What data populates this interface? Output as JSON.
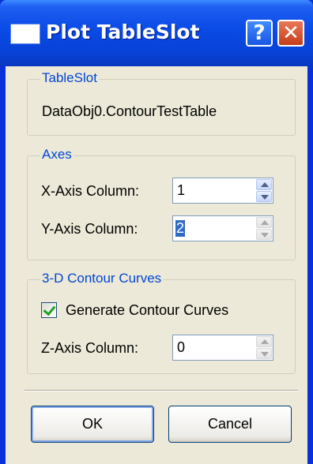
{
  "window": {
    "title": "Plot TableSlot",
    "help_glyph": "?",
    "close_glyph": "✕"
  },
  "table_slot": {
    "group_title": "TableSlot",
    "value": "DataObj0.ContourTestTable"
  },
  "axes": {
    "group_title": "Axes",
    "x_label": "X-Axis Column:",
    "x_value": "1",
    "y_label": "Y-Axis Column:",
    "y_value": "2"
  },
  "contour": {
    "group_title": "3-D Contour Curves",
    "generate_label": "Generate Contour Curves",
    "generate_checked": true,
    "z_label": "Z-Axis Column:",
    "z_value": "0"
  },
  "buttons": {
    "ok": "OK",
    "cancel": "Cancel"
  }
}
